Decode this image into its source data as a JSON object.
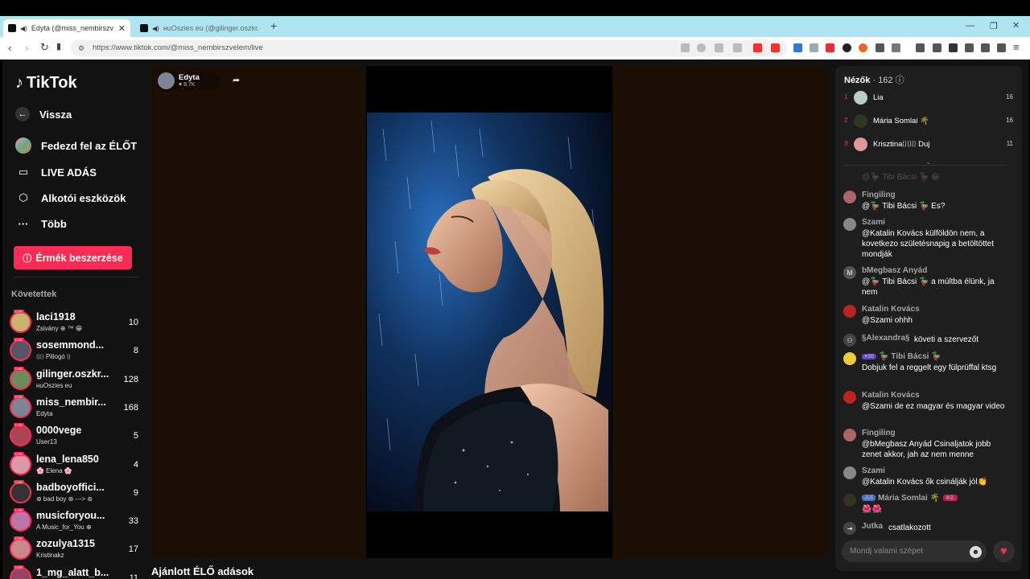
{
  "browser": {
    "tabs": [
      {
        "title": "Edyta (@miss_nembirszvelem",
        "active": true
      },
      {
        "title": "ʜuOszies eu (@gilinger.oszkr.jn) li",
        "active": false
      }
    ],
    "url": "https://www.tiktok.com/@miss_nembirszvelem/live",
    "new_tab": "+",
    "close_tab": "✕"
  },
  "sidebar": {
    "logo": "TikTok",
    "back": "Vissza",
    "explore_live": "Fedezd fel az ÉLŐT",
    "live_broadcast": "LIVE ADÁS",
    "creator_tools": "Alkotói eszközök",
    "more": "Több",
    "get_coins": "Érmék beszerzése",
    "following_title": "Követettek",
    "following": [
      {
        "name": "laci1918",
        "sub": "Zsivány ⊕ ™ 😁",
        "count": "10",
        "color": "#c9b26a"
      },
      {
        "name": "sosemmond...",
        "sub": "⌷⌷ Pillogó ⌷",
        "count": "8",
        "color": "#556"
      },
      {
        "name": "gilinger.oszkr...",
        "sub": "ʜuOszies eu",
        "count": "128",
        "color": "#6b8b5a"
      },
      {
        "name": "miss_nembir...",
        "sub": "Edyta",
        "count": "168",
        "color": "#7b8593"
      },
      {
        "name": "0000vege",
        "sub": "User13",
        "count": "5",
        "color": "#a45"
      },
      {
        "name": "lena_lena850",
        "sub": "🌸 Elena 🌸",
        "count": "4",
        "color": "#d9a"
      },
      {
        "name": "badboyoffici...",
        "sub": "⊛ bad boy ⊛ ---> ⊛",
        "count": "9",
        "color": "#333"
      },
      {
        "name": "musicforyou...",
        "sub": "A Music_for_You ⊕",
        "count": "33",
        "color": "#b7a"
      },
      {
        "name": "zozulya1315",
        "sub": "Kristinakz",
        "count": "17",
        "color": "#c88"
      },
      {
        "name": "1_mg_alatt_b...",
        "sub": "",
        "count": "11",
        "color": "#946"
      }
    ]
  },
  "stream": {
    "host_name": "Edyta",
    "host_likes": "♥ 8.7K",
    "suggested_title": "Ajánlott ÉLŐ adások"
  },
  "chat": {
    "viewers_label": "Nézők",
    "viewers_count": "· 162 ⓘ",
    "top_viewers": [
      {
        "rank": "1",
        "name": "Lia",
        "score": "16",
        "color": "#bcc"
      },
      {
        "rank": "2",
        "name": "Mária Somlai 🌴",
        "score": "16",
        "color": "#332"
      },
      {
        "rank": "3",
        "name": "Krisztina⌷⌷⌷ Duj",
        "score": "11",
        "color": "#d99"
      }
    ],
    "faded_message": "@🦆 Tibi Bácsi 🦆 😁",
    "messages": [
      {
        "user": "Fingiling",
        "text": "@🦆 Tibi Bácsi 🦆 Es?",
        "avatar": "#a66",
        "letter": ""
      },
      {
        "user": "Szami",
        "text": "@Katalin Kovács külföldön nem, a kovetkezo születésnapig a betöltöttet mondják",
        "avatar": "#888",
        "letter": ""
      },
      {
        "user": "bMegbasz Anyád",
        "text": "@🦆 Tibi Bácsi 🦆 a múltba élünk, ja nem",
        "avatar": "#555",
        "letter": "M"
      },
      {
        "user": "Katalin Kovács",
        "text": "@Szami ohhh",
        "avatar": "#b22",
        "letter": ""
      },
      {
        "user": "§Alexandra§",
        "text": "követi a szervezőt",
        "avatar": "#444",
        "letter": "⚇"
      },
      {
        "user": "Tibi Bácsi 🦆",
        "badge": "♥30",
        "prefix": "🦆",
        "text": "Dobjuk fel a reggelt egy fülprüffal ktsg",
        "avatar": "#ec3",
        "letter": ""
      },
      {
        "user": "Katalin Kovács",
        "text": "@Szami de ez magyar és magyar video",
        "avatar": "#b22",
        "letter": ""
      },
      {
        "user": "Fingiling",
        "text": "@bMegbasz Anyád Csinaljatok jobb zenet akkor, jah az nem menne",
        "avatar": "#a66",
        "letter": ""
      },
      {
        "user": "Szami",
        "text": "@Katalin Kovács ők csinálják jól👏",
        "avatar": "#888",
        "letter": ""
      },
      {
        "user": "Mária Somlai 🌴",
        "badge": "⁂6",
        "badge2": "⊕2.",
        "text": "🌺🌺",
        "avatar": "#332",
        "letter": ""
      },
      {
        "user": "Jutka",
        "text": "csatlakozott",
        "avatar": "#444",
        "letter": "⇥"
      }
    ],
    "input_placeholder": "Mondj valami szépet",
    "emoji": "☻",
    "gift": "♥"
  }
}
